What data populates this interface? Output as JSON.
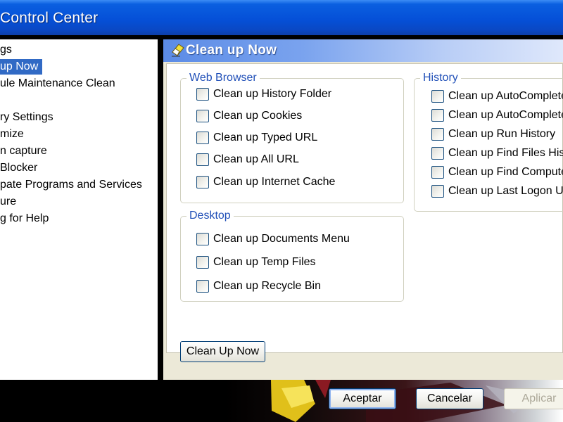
{
  "window": {
    "title": "Control Center"
  },
  "tree": {
    "items": [
      {
        "label": "gs",
        "selected": false
      },
      {
        "label": "up Now",
        "selected": true
      },
      {
        "label": "ule Maintenance Clean",
        "selected": false
      },
      {
        "label": "",
        "selected": false
      },
      {
        "label": "ry Settings",
        "selected": false
      },
      {
        "label": "mize",
        "selected": false
      },
      {
        "label": "n capture",
        "selected": false
      },
      {
        "label": "Blocker",
        "selected": false
      },
      {
        "label": "pate Programs and  Services",
        "selected": false
      },
      {
        "label": "ure",
        "selected": false
      },
      {
        "label": "g for Help",
        "selected": false
      }
    ]
  },
  "panel": {
    "title": "Clean up Now",
    "icon": "eraser-icon"
  },
  "groups": {
    "web_browser": {
      "label": "Web Browser",
      "items": [
        {
          "label": "Clean up History Folder",
          "checked": false
        },
        {
          "label": "Clean up Cookies",
          "checked": false
        },
        {
          "label": "Clean up Typed URL",
          "checked": false
        },
        {
          "label": "Clean up All URL",
          "checked": false
        },
        {
          "label": "Clean up Internet Cache",
          "checked": false
        }
      ]
    },
    "desktop": {
      "label": "Desktop",
      "items": [
        {
          "label": "Clean up Documents Menu",
          "checked": false
        },
        {
          "label": "Clean up Temp Files",
          "checked": false
        },
        {
          "label": "Clean up Recycle Bin",
          "checked": false
        }
      ]
    },
    "history": {
      "label": "History",
      "items": [
        {
          "label": "Clean up AutoComplete",
          "checked": false
        },
        {
          "label": "Clean up AutoComplete",
          "checked": false
        },
        {
          "label": "Clean up Run History",
          "checked": false
        },
        {
          "label": "Clean up Find Files Hist",
          "checked": false
        },
        {
          "label": "Clean up Find Compute",
          "checked": false
        },
        {
          "label": "Clean up Last Logon Us",
          "checked": false
        }
      ]
    }
  },
  "buttons": {
    "clean_up_now": "Clean Up Now",
    "accept": "Aceptar",
    "cancel": "Cancelar",
    "apply": "Aplicar"
  },
  "colors": {
    "titlebar": "#0550d8",
    "selection": "#316ac5",
    "group_label": "#2150b8",
    "panel_bg": "#ece9d8"
  }
}
